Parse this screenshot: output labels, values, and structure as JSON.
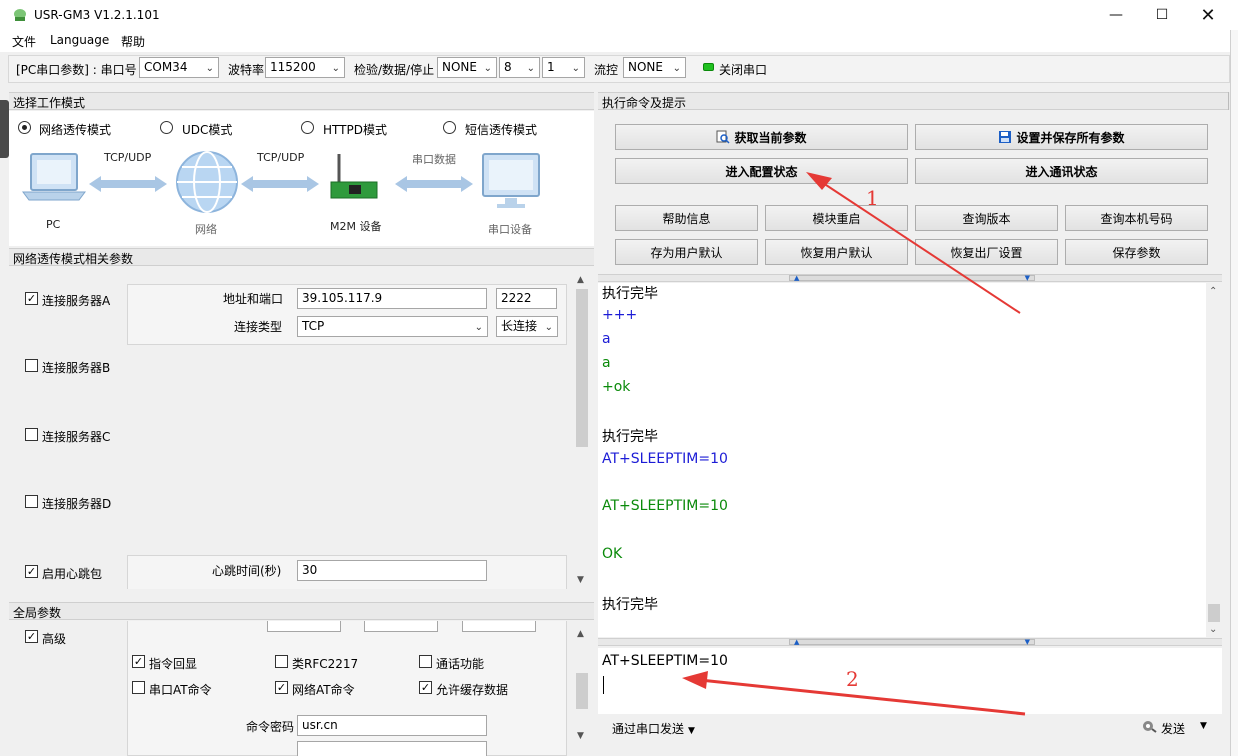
{
  "window": {
    "title": "USR-GM3 V1.2.1.101"
  },
  "menu": {
    "file": "文件",
    "language": "Language",
    "help": "帮助"
  },
  "toolbar": {
    "params_label": "[PC串口参数] : 串口号",
    "port": "COM34",
    "baud_label": "波特率",
    "baud": "115200",
    "parity_label": "检验/数据/停止",
    "parity": "NONE",
    "databits": "8",
    "stopbits": "1",
    "flow_label": "流控",
    "flow": "NONE",
    "close_port": "关闭串口",
    "status_color": "#20c020"
  },
  "work_mode": {
    "header": "选择工作模式",
    "modes": [
      "网络透传模式",
      "UDC模式",
      "HTTPD模式",
      "短信透传模式"
    ],
    "selected": "网络透传模式",
    "diagram": {
      "pc": "PC",
      "link1": "TCP/UDP",
      "network": "网络",
      "link2": "TCP/UDP",
      "m2m": "M2M 设备",
      "link3": "串口数据",
      "serial_device": "串口设备"
    }
  },
  "net_params": {
    "header": "网络透传模式相关参数",
    "server_a": {
      "label": "连接服务器A",
      "checked": true,
      "addr_label": "地址和端口",
      "addr": "39.105.117.9",
      "port": "2222",
      "type_label": "连接类型",
      "type": "TCP",
      "conn": "长连接"
    },
    "server_b": {
      "label": "连接服务器B",
      "checked": false
    },
    "server_c": {
      "label": "连接服务器C",
      "checked": false
    },
    "server_d": {
      "label": "连接服务器D",
      "checked": false
    },
    "heartbeat": {
      "label": "启用心跳包",
      "checked": true,
      "time_label": "心跳时间(秒)",
      "time": "30"
    }
  },
  "global_params": {
    "header": "全局参数",
    "advanced": {
      "label": "高级",
      "checked": true
    },
    "options": [
      {
        "label": "指令回显",
        "checked": true
      },
      {
        "label": "类RFC2217",
        "checked": false
      },
      {
        "label": "通话功能",
        "checked": false
      },
      {
        "label": "串口AT命令",
        "checked": false
      },
      {
        "label": "网络AT命令",
        "checked": true
      },
      {
        "label": "允许缓存数据",
        "checked": true
      }
    ],
    "password_label": "命令密码",
    "password": "usr.cn"
  },
  "commands": {
    "header": "执行命令及提示",
    "get_params": "获取当前参数",
    "save_all": "设置并保存所有参数",
    "enter_config": "进入配置状态",
    "enter_comm": "进入通讯状态",
    "help_info": "帮助信息",
    "restart": "模块重启",
    "query_version": "查询版本",
    "query_number": "查询本机号码",
    "save_user_default": "存为用户默认",
    "restore_user_default": "恢复用户默认",
    "restore_factory": "恢复出厂设置",
    "save_params": "保存参数"
  },
  "log": [
    {
      "text": "执行完毕",
      "color": "black"
    },
    {
      "text": "+++",
      "color": "blue"
    },
    {
      "text": "a",
      "color": "blue"
    },
    {
      "text": "a",
      "color": "green"
    },
    {
      "text": "+ok",
      "color": "green"
    },
    {
      "text": "",
      "color": "black"
    },
    {
      "text": "执行完毕",
      "color": "black"
    },
    {
      "text": "AT+SLEEPTIM=10",
      "color": "blue"
    },
    {
      "text": "",
      "color": "black"
    },
    {
      "text": "AT+SLEEPTIM=10",
      "color": "green"
    },
    {
      "text": "",
      "color": "black"
    },
    {
      "text": "OK",
      "color": "green"
    },
    {
      "text": "",
      "color": "black"
    },
    {
      "text": "执行完毕",
      "color": "black"
    }
  ],
  "send": {
    "input_value": "AT+SLEEPTIM=10",
    "via_label": "通过串口发送",
    "send_button": "发送"
  },
  "annotations": {
    "one": "1",
    "two": "2",
    "color": "#e53935"
  }
}
